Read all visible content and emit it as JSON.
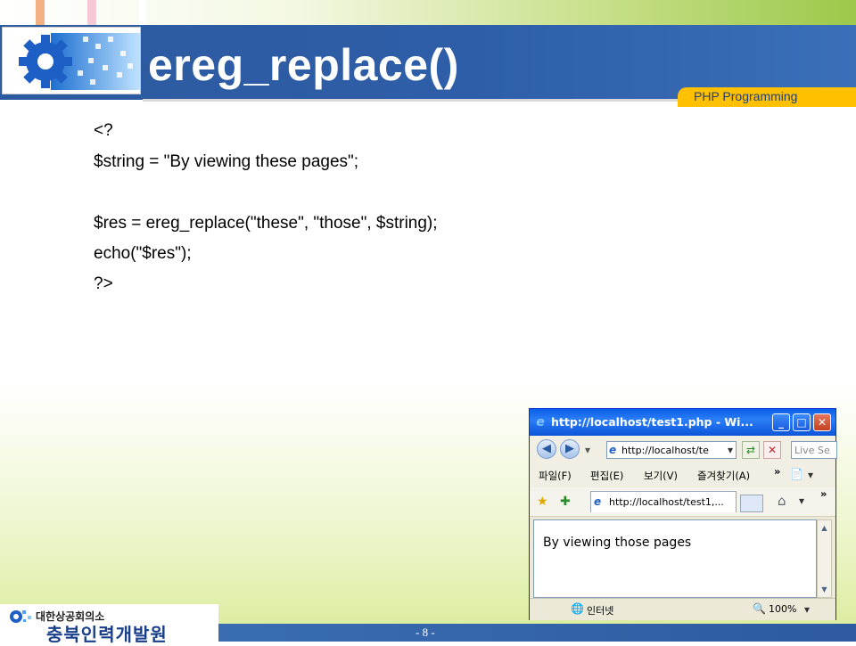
{
  "slide": {
    "title": "ereg_replace()",
    "tag": "PHP Programming",
    "page_number": "- 8 -",
    "footer_org_small": "대한상공회의소",
    "footer_org_big": "충북인력개발원"
  },
  "code": {
    "lines": [
      "<?",
      "$string = \"By viewing these pages\";",
      "$res = ereg_replace(\"these\", \"those\", $string);",
      "echo(\"$res\");",
      "?>"
    ]
  },
  "browser": {
    "title": "http://localhost/test1.php - Wi...",
    "address": "http://localhost/te",
    "search_placeholder": "Live Se",
    "menu": {
      "file": "파일(F)",
      "edit": "편집(E)",
      "view": "보기(V)",
      "favorites": "즐겨찾기(A)",
      "more": "»"
    },
    "tab_label": "http://localhost/test1,...",
    "toolbar_more": "»",
    "content_text": "By viewing those pages",
    "status_zone": "인터넷",
    "zoom": "100%"
  },
  "colors": {
    "title_bar": "#2c5aa0",
    "tag_tab": "#ffc000",
    "window_title": "#0a5fe6"
  }
}
